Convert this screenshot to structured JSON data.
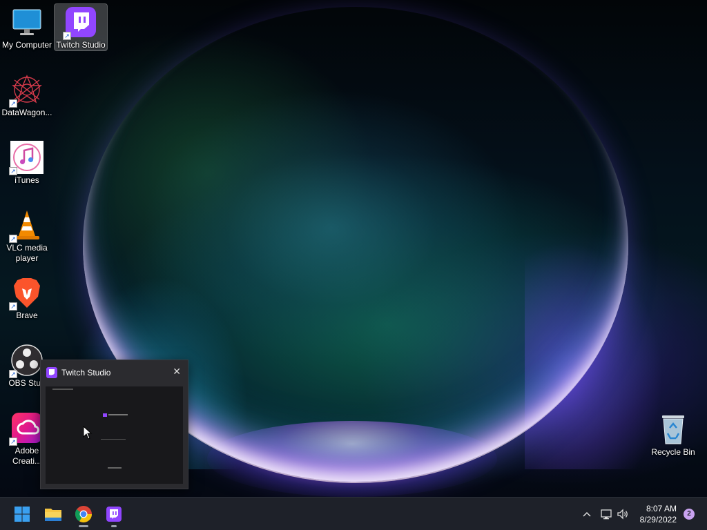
{
  "desktop": {
    "icons": [
      {
        "label": "My Computer",
        "icon": "monitor-icon"
      },
      {
        "label": "Twitch Studio",
        "icon": "twitch-studio-icon",
        "selected": true
      },
      {
        "label": "DataWagon...",
        "icon": "datawagon-icon"
      },
      {
        "label": "iTunes",
        "icon": "itunes-icon"
      },
      {
        "label": "VLC media player",
        "icon": "vlc-icon"
      },
      {
        "label": "Brave",
        "icon": "brave-icon"
      },
      {
        "label": "OBS Stud",
        "icon": "obs-icon"
      },
      {
        "label": "Adobe Creati...",
        "icon": "adobe-cc-icon"
      },
      {
        "label": "Recycle Bin",
        "icon": "recycle-bin-icon"
      }
    ]
  },
  "preview": {
    "title": "Twitch Studio",
    "close_glyph": "✕"
  },
  "taskbar": {
    "apps": [
      {
        "name": "Start",
        "icon": "windows-start-icon"
      },
      {
        "name": "File Explorer",
        "icon": "folder-icon"
      },
      {
        "name": "Google Chrome",
        "icon": "chrome-icon"
      },
      {
        "name": "Twitch Studio",
        "icon": "twitch-studio-icon"
      }
    ],
    "tray": {
      "chevron_glyph": "^",
      "time": "8:07 AM",
      "date": "8/29/2022",
      "notifications": "2"
    }
  },
  "colors": {
    "twitch_purple": "#9146ff",
    "taskbar_bg": "#1e2129"
  }
}
